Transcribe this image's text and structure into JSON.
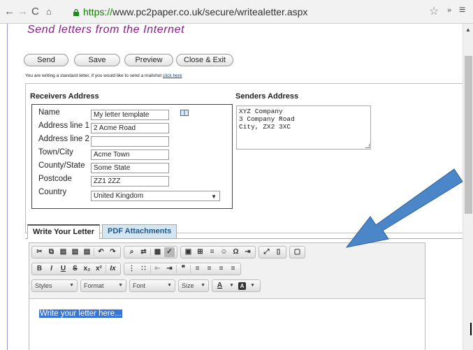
{
  "browser": {
    "url_scheme": "https://",
    "url_rest": "www.pc2paper.co.uk/secure/writealetter.aspx"
  },
  "page": {
    "headline": "Send letters from the Internet",
    "buttons": {
      "send": "Send",
      "save": "Save",
      "preview": "Preview",
      "close": "Close & Exit"
    },
    "note_text": "You are writing a standard letter, if you would like to send a mailshot ",
    "note_link": "click here"
  },
  "receivers": {
    "heading": "Receivers Address",
    "fields": {
      "name_label": "Name",
      "name_value": "My letter template",
      "addr1_label": "Address line 1",
      "addr1_value": "2 Acme Road",
      "addr2_label": "Address line 2",
      "addr2_value": "",
      "town_label": "Town/City",
      "town_value": "Acme Town",
      "county_label": "County/State",
      "county_value": "Some State",
      "post_label": "Postcode",
      "post_value": "ZZ1 2ZZ",
      "country_label": "Country",
      "country_value": "United Kingdom"
    }
  },
  "senders": {
    "heading": "Senders Address",
    "text": "XYZ Company\n3 Company Road\nCity, ZX2 3XC"
  },
  "tabs": {
    "write": "Write Your Letter",
    "pdf": "PDF Attachments"
  },
  "toolbar": {
    "styles": "Styles",
    "format": "Format",
    "font": "Font",
    "size": "Size"
  },
  "editor": {
    "placeholder": "Write your letter here..."
  },
  "colors": {
    "headline": "#8b1a8b",
    "arrow": "#4a86c8",
    "selection": "#3875d7"
  }
}
